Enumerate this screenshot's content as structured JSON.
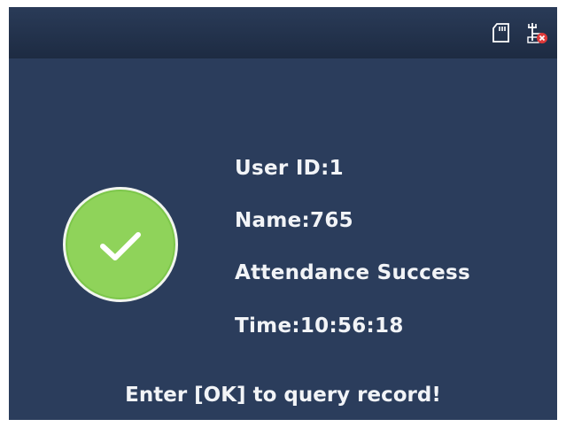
{
  "status_bar": {
    "icons": [
      "sd-card-icon",
      "network-disconnected-icon"
    ]
  },
  "result": {
    "icon": "check-icon",
    "circle_color": "#8fd35a"
  },
  "record": {
    "user_id": "User ID:1",
    "name": "Name:765",
    "status": "Attendance Success",
    "time": "Time:10:56:18"
  },
  "footer": {
    "prompt": "Enter [OK] to query record!"
  },
  "colors": {
    "background": "#2b3d5c",
    "status_bar": "#1d2b42",
    "text": "#f2f4f7",
    "error_badge": "#e03a3a"
  }
}
